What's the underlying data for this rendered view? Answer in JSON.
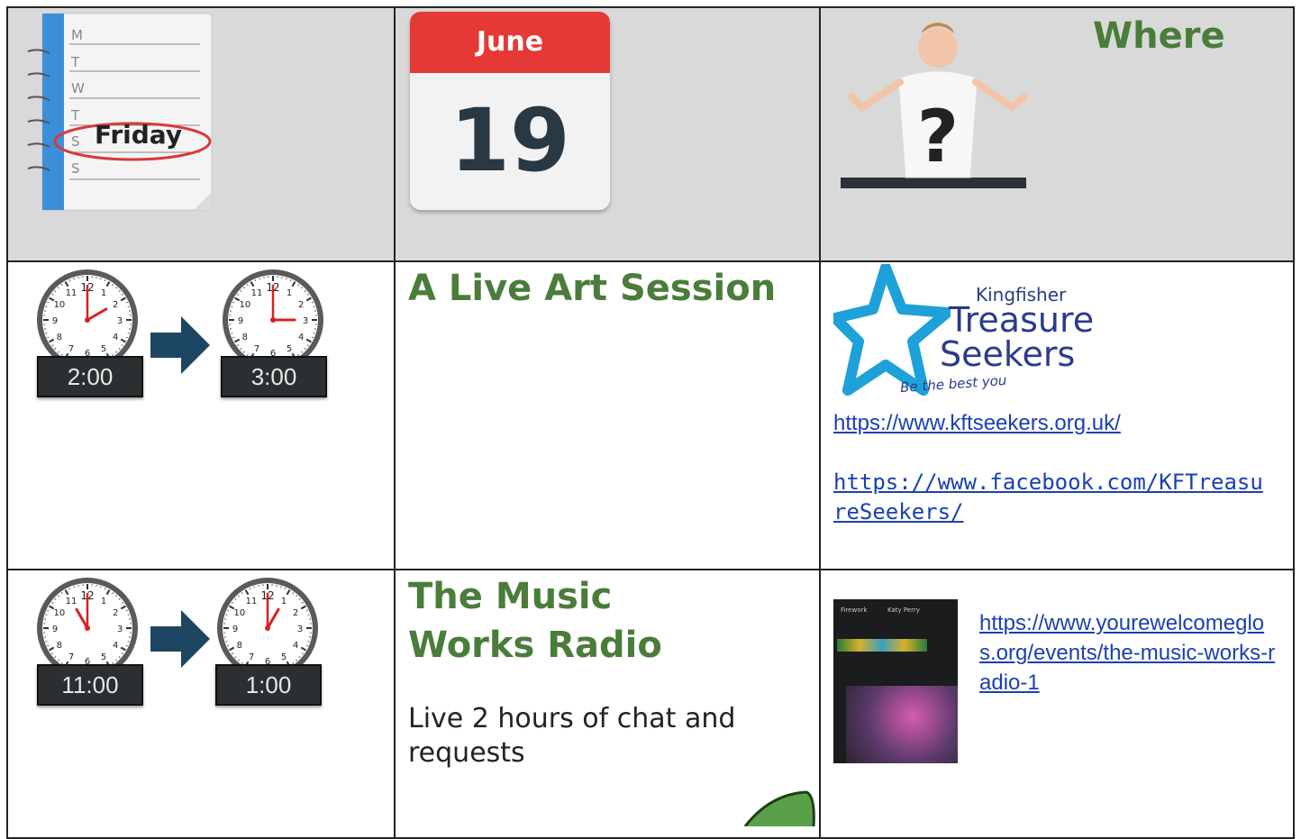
{
  "header": {
    "day_label": "Friday",
    "weekday_letters": [
      "M",
      "T",
      "W",
      "T",
      "",
      "S",
      "S"
    ],
    "month": "June",
    "date_number": "19",
    "where_label": "Where",
    "question_mark": "?"
  },
  "rows": [
    {
      "start_time": "2:00",
      "end_time": "3:00",
      "start_clock": {
        "hour": 2,
        "minute": 0
      },
      "end_clock": {
        "hour": 3,
        "minute": 0
      },
      "title": "A Live Art Session",
      "logo": {
        "line1": "Kingfisher",
        "line2": "Treasure",
        "line3": "Seekers",
        "tagline": "Be the best you"
      },
      "links": [
        "https://www.kftseekers.org.uk/",
        "https://www.facebook.com/KFTreasureSeekers/"
      ]
    },
    {
      "start_time": "11:00",
      "end_time": "1:00",
      "start_clock": {
        "hour": 11,
        "minute": 0
      },
      "end_clock": {
        "hour": 1,
        "minute": 0
      },
      "title_line1": "The Music",
      "title_line2": "Works Radio",
      "description": "Live 2 hours of chat and requests",
      "thumb_labels": {
        "left": "Firework",
        "mid": "Katy Perry"
      },
      "link": "https://www.yourewelcomeglos.org/events/the-music-works-radio-1"
    }
  ],
  "colors": {
    "title_green": "#4a7c3a",
    "header_gray": "#d9d9d9",
    "link_blue": "#1a3fb5",
    "arrow_navy": "#1d4663",
    "calendar_red": "#e53935"
  }
}
